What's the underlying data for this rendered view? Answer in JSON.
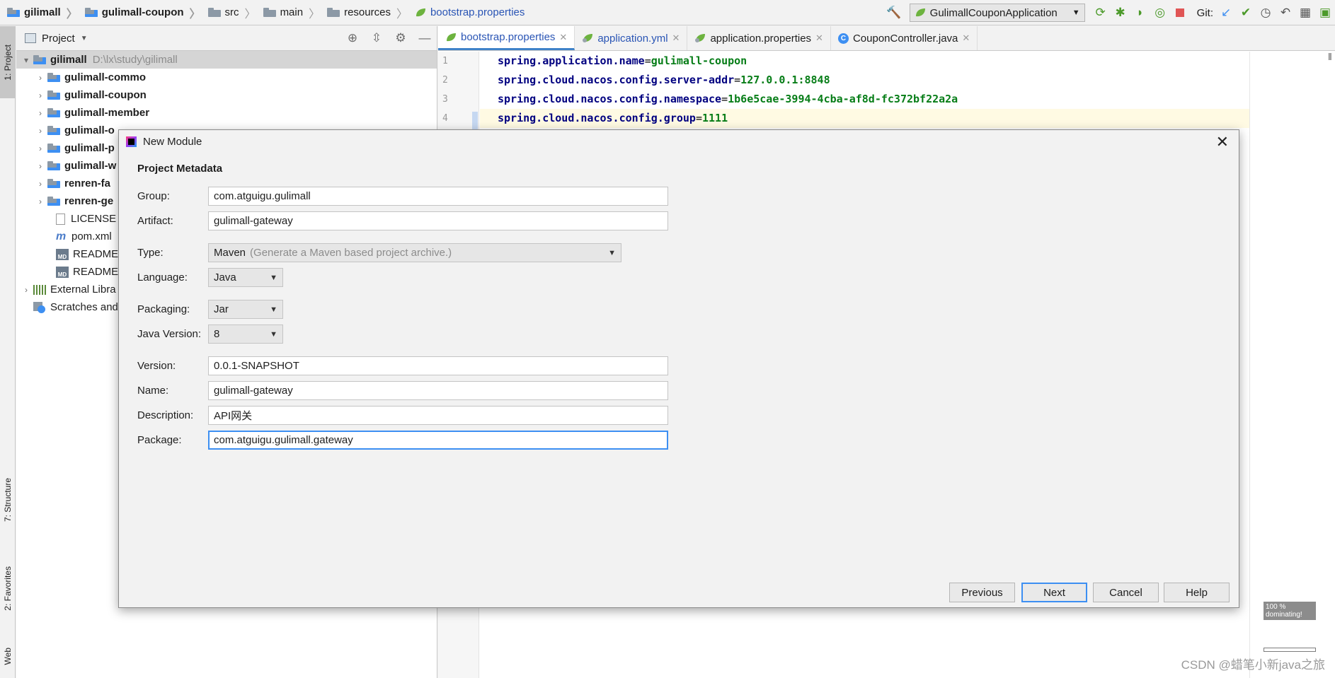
{
  "breadcrumb": [
    "gilimall",
    "gulimall-coupon",
    "src",
    "main",
    "resources",
    "bootstrap.properties"
  ],
  "run_config": "GulimallCouponApplication",
  "git_label": "Git:",
  "stripe": {
    "project": "1: Project",
    "structure": "7: Structure",
    "favorites": "2: Favorites",
    "web": "Web"
  },
  "project_panel": {
    "title": "Project",
    "root_name": "gilimall",
    "root_path": "D:\\lx\\study\\gilimall",
    "items": [
      {
        "label": "gulimall-commo",
        "kind": "module"
      },
      {
        "label": "gulimall-coupon",
        "kind": "module"
      },
      {
        "label": "gulimall-member",
        "kind": "module"
      },
      {
        "label": "gulimall-o",
        "kind": "module"
      },
      {
        "label": "gulimall-p",
        "kind": "module"
      },
      {
        "label": "gulimall-w",
        "kind": "module"
      },
      {
        "label": "renren-fa",
        "kind": "module"
      },
      {
        "label": "renren-ge",
        "kind": "module"
      },
      {
        "label": "LICENSE",
        "kind": "file"
      },
      {
        "label": "pom.xml",
        "kind": "maven"
      },
      {
        "label": "README.",
        "kind": "md"
      },
      {
        "label": "README.",
        "kind": "md"
      }
    ],
    "external": "External Libra",
    "scratches": "Scratches and"
  },
  "editor": {
    "tabs": [
      {
        "label": "bootstrap.properties",
        "active": true
      },
      {
        "label": "application.yml",
        "active": false
      },
      {
        "label": "application.properties",
        "active": false
      },
      {
        "label": "CouponController.java",
        "active": false
      }
    ],
    "lines": [
      {
        "num": "1",
        "key": "spring.application.name",
        "value": "gulimall-coupon"
      },
      {
        "num": "2",
        "key": "spring.cloud.nacos.config.server-addr",
        "value": "127.0.0.1:8848"
      },
      {
        "num": "3",
        "key": "spring.cloud.nacos.config.namespace",
        "value": "1b6e5cae-3994-4cba-af8d-fc372bf22a2a"
      },
      {
        "num": "4",
        "key": "spring.cloud.nacos.config.group",
        "value": "1111"
      }
    ]
  },
  "dialog": {
    "title": "New Module",
    "section": "Project Metadata",
    "labels": {
      "group": "Group:",
      "artifact": "Artifact:",
      "type": "Type:",
      "language": "Language:",
      "packaging": "Packaging:",
      "java_version": "Java Version:",
      "version": "Version:",
      "name": "Name:",
      "description": "Description:",
      "package": "Package:"
    },
    "values": {
      "group": "com.atguigu.gulimall",
      "artifact": "gulimall-gateway",
      "type": "Maven",
      "type_hint": "(Generate a Maven based project archive.)",
      "language": "Java",
      "packaging": "Jar",
      "java_version": "8",
      "version": "0.0.1-SNAPSHOT",
      "name": "gulimall-gateway",
      "description": "API网关",
      "package": "com.atguigu.gulimall.gateway"
    },
    "buttons": {
      "previous": "Previous",
      "next": "Next",
      "cancel": "Cancel",
      "help": "Help"
    }
  },
  "zoom_badge": "100 % dominating!",
  "watermark": "CSDN @蜡笔小新java之旅",
  "colors": {
    "accent": "#3d8ff2",
    "property_key": "#000080",
    "property_value": "#067d17",
    "link_blue": "#2a55b5"
  }
}
